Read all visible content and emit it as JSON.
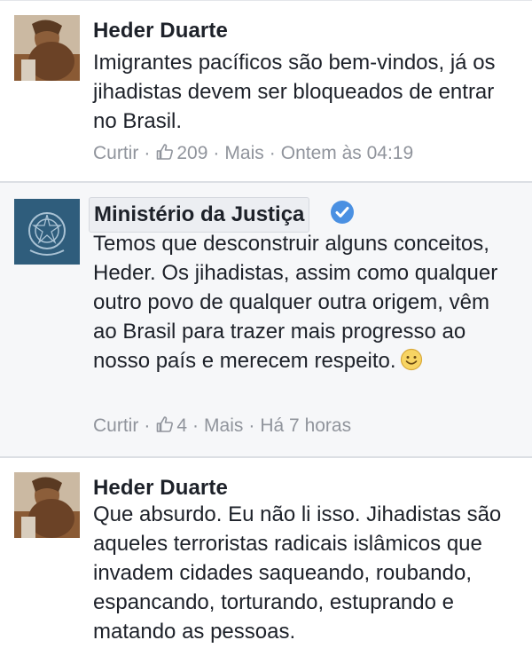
{
  "comments": [
    {
      "author": "Heder Duarte",
      "text": "Imigrantes pacíficos são bem-vindos, já os jihadistas devem ser bloqueados de entrar no Brasil.",
      "actions": {
        "like_label": "Curtir",
        "like_count": "209",
        "more_label": "Mais",
        "timestamp": "Ontem às 04:19"
      }
    },
    {
      "author": "Ministério da Justiça",
      "verified": true,
      "text": "Temos que desconstruir alguns conceitos, Heder. Os jihadistas, assim como qualquer outro povo de qualquer outra origem, vêm ao Brasil para trazer mais progresso ao nosso país e merecem respeito.",
      "emoji": "smiley-face",
      "actions": {
        "like_label": "Curtir",
        "like_count": "4",
        "more_label": "Mais",
        "timestamp": "Há 7 horas"
      }
    },
    {
      "author": "Heder Duarte",
      "text": "Que absurdo. Eu não li isso. Jihadistas são aqueles terroristas radicais islâmicos que invadem cidades saqueando, roubando, espancando, torturando, estuprando e matando as pessoas."
    }
  ],
  "separator": "·",
  "colors": {
    "link_gray": "#90949c",
    "verified_blue": "#4a90e2",
    "ministry_avatar_bg": "#2f5d7c",
    "highlight_bg": "#f6f7f9"
  }
}
